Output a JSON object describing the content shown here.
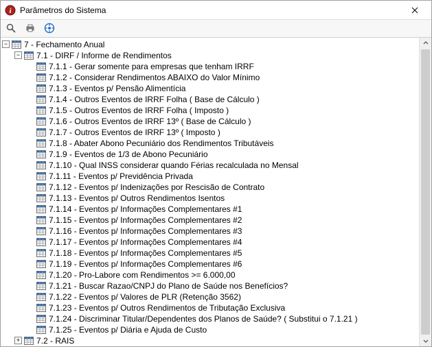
{
  "window": {
    "title": "Parâmetros do Sistema"
  },
  "toolbar": {
    "search_tip": "Pesquisar",
    "print_tip": "Imprimir",
    "help_tip": "Ajuda"
  },
  "tree": {
    "root": {
      "label": "7 - Fechamento Anual",
      "expanded": true,
      "children": [
        {
          "label": "7.1 - DIRF / Informe de Rendimentos",
          "expanded": true,
          "items": [
            "7.1.1 - Gerar somente para empresas que tenham IRRF",
            "7.1.2 - Considerar Rendimentos ABAIXO do Valor Mínimo",
            "7.1.3 - Eventos p/ Pensão Alimentícia",
            "7.1.4 - Outros Eventos de IRRF Folha ( Base de Cálculo )",
            "7.1.5 - Outros Eventos de IRRF Folha ( Imposto )",
            "7.1.6 - Outros Eventos de IRRF 13º ( Base de Cálculo )",
            "7.1.7 - Outros Eventos de IRRF 13º ( Imposto )",
            "7.1.8 - Abater Abono Pecuniário dos Rendimentos Tributáveis",
            "7.1.9 - Eventos de 1/3 de Abono Pecuniário",
            "7.1.10 - Qual INSS considerar quando Férias recalculada no Mensal",
            "7.1.11 - Eventos p/ Previdência Privada",
            "7.1.12 - Eventos p/ Indenizações por Rescisão de Contrato",
            "7.1.13 - Eventos p/ Outros Rendimentos Isentos",
            "7.1.14 - Eventos p/ Informações Complementares #1",
            "7.1.15 - Eventos p/ Informações Complementares #2",
            "7.1.16 - Eventos p/ Informações Complementares #3",
            "7.1.17 - Eventos p/ Informações Complementares #4",
            "7.1.18 - Eventos p/ Informações Complementares #5",
            "7.1.19 - Eventos p/ Informações Complementares #6",
            "7.1.20 - Pro-Labore com Rendimentos >= 6.000,00",
            "7.1.21 - Buscar Razao/CNPJ do Plano de Saúde nos Benefícios?",
            "7.1.22 - Eventos p/ Valores de PLR (Retenção 3562)",
            "7.1.23 - Eventos p/ Outros Rendimentos de Tributação Exclusiva",
            "7.1.24 - Discriminar Titular/Dependentes dos Planos de Saúde? ( Substitui o 7.1.21 )",
            "7.1.25 - Eventos p/ Diária e Ajuda de Custo"
          ]
        },
        {
          "label": "7.2 - RAIS",
          "expanded": false
        }
      ]
    }
  }
}
